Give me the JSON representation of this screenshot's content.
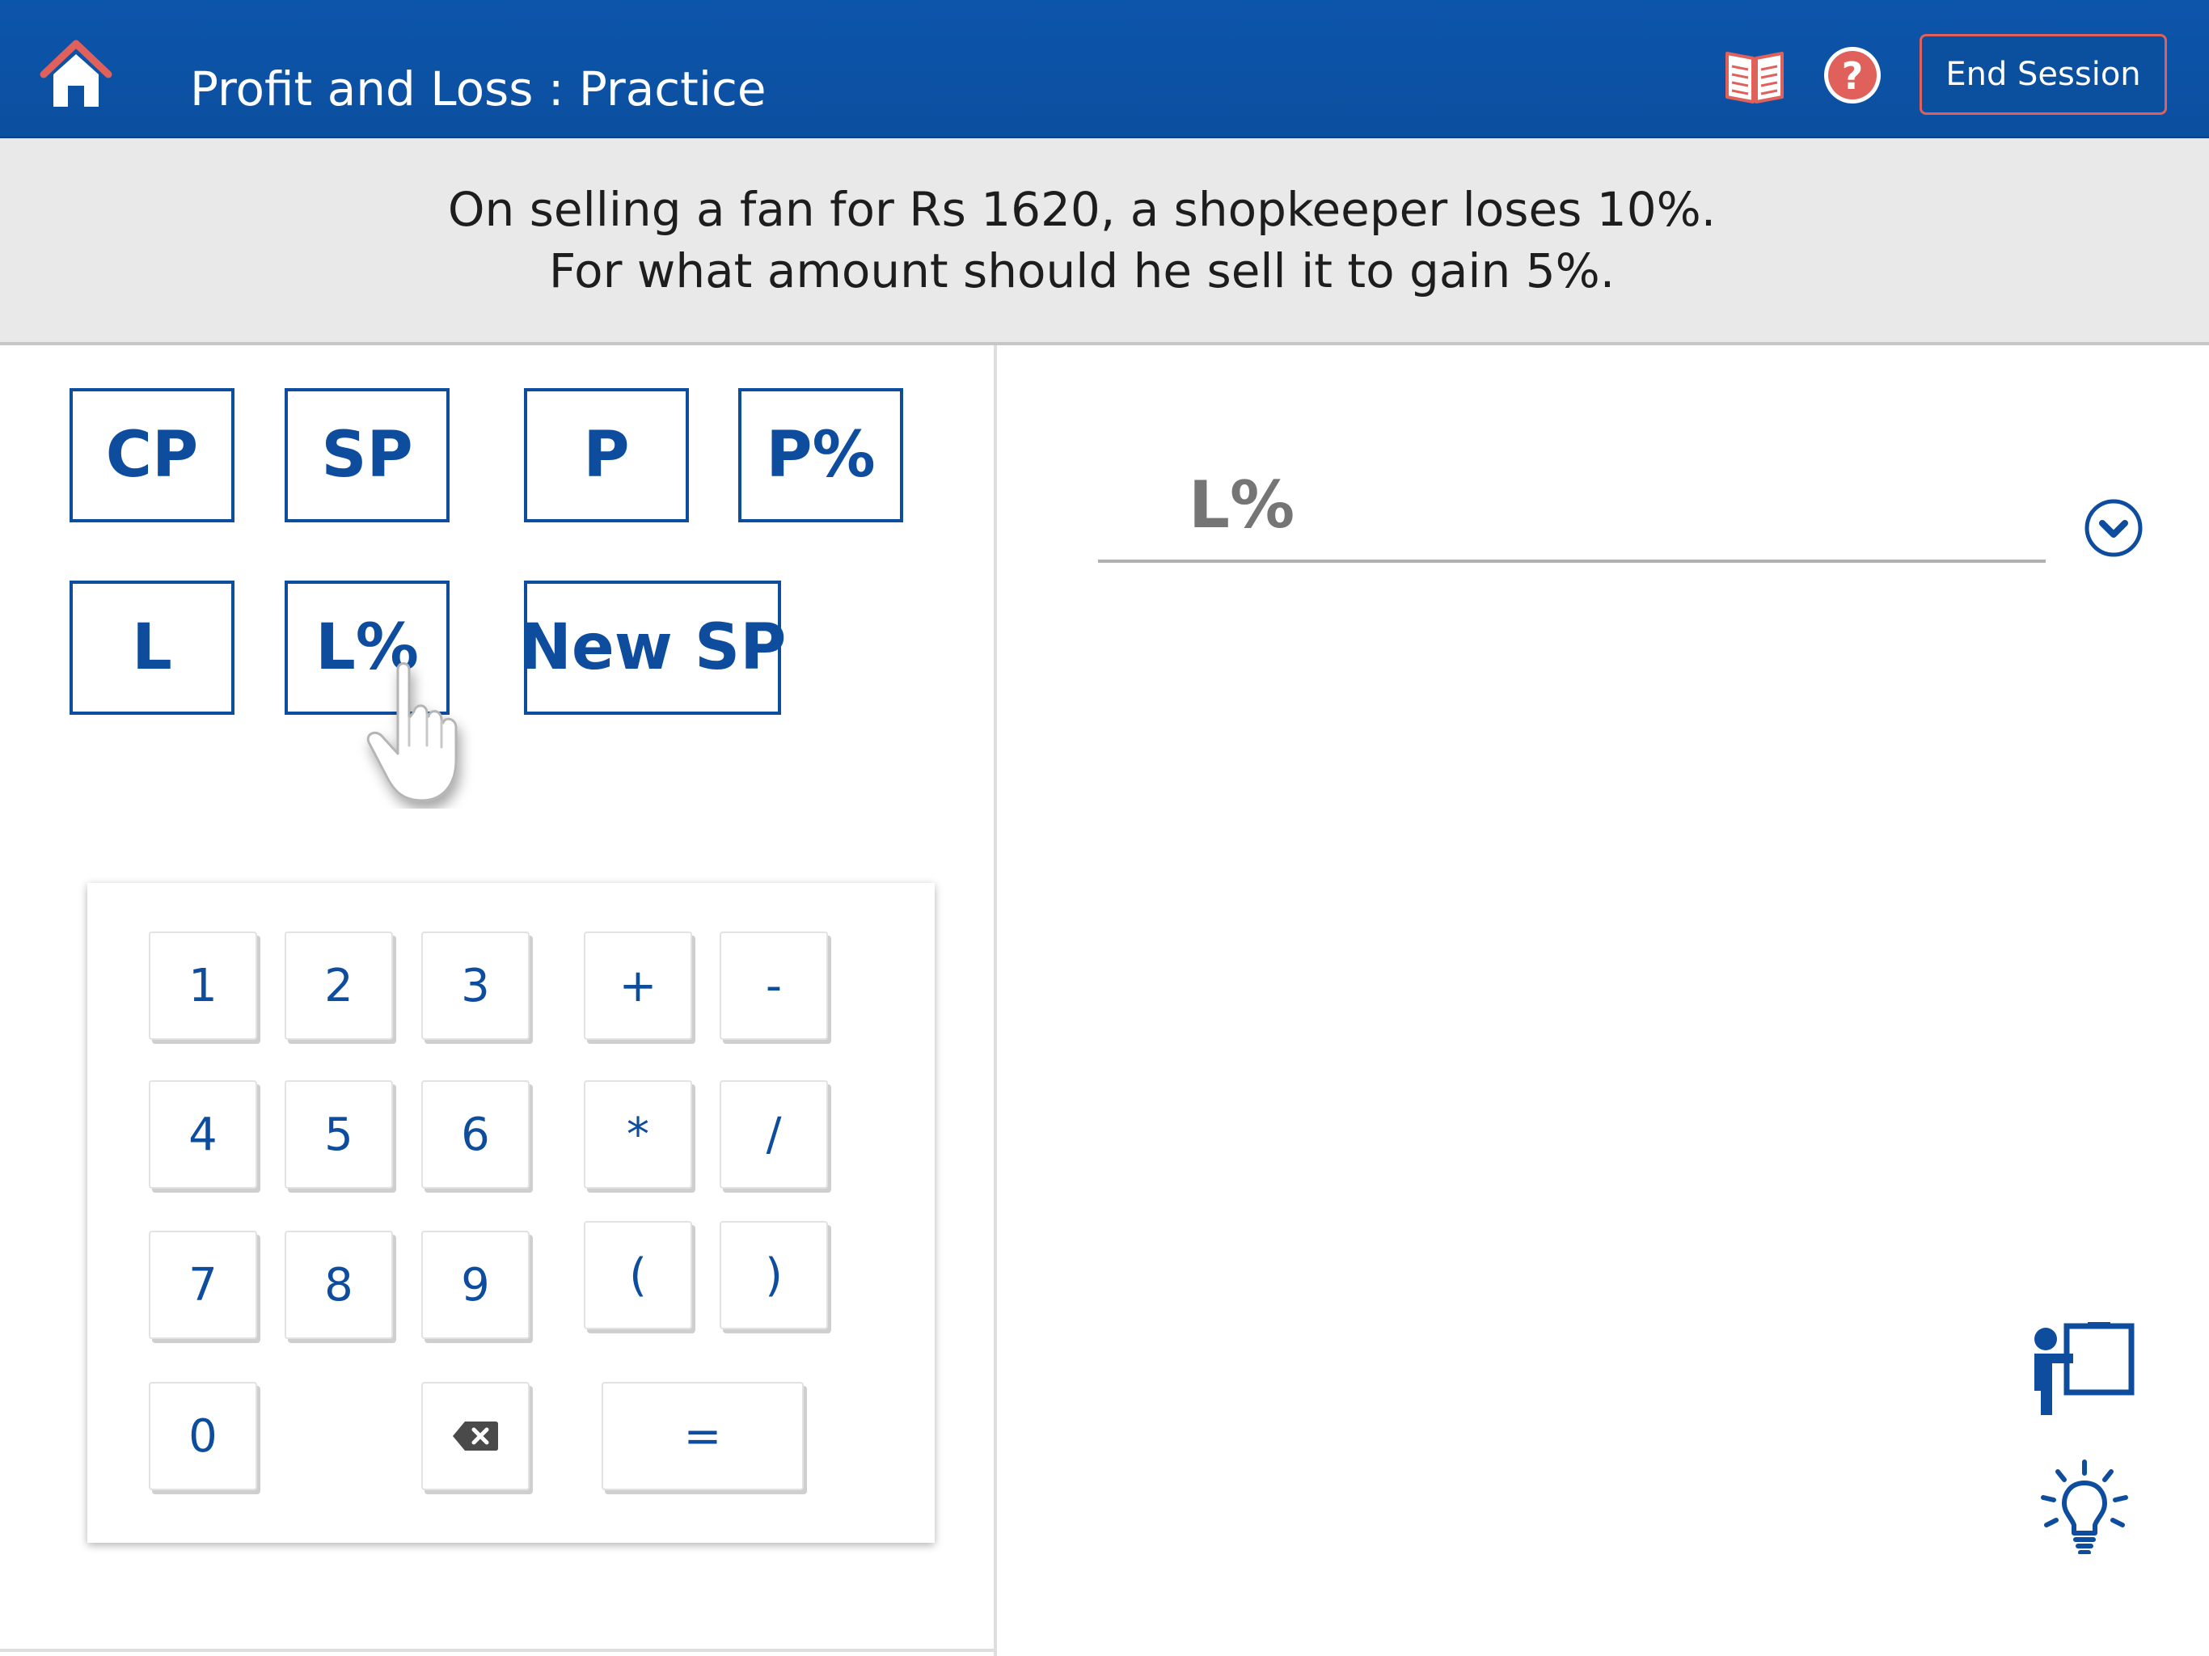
{
  "header": {
    "title": "Profit and Loss : Practice",
    "end_session_label": "End Session",
    "icons": {
      "home": "home-icon",
      "book": "book-icon",
      "help": "help-icon"
    },
    "colors": {
      "bar": "#0b4f9f",
      "end_session_border": "#e0615b",
      "help": "#e0615b"
    }
  },
  "question": {
    "line1": "On selling a fan for Rs 1620, a shopkeeper loses 10%.",
    "line2": "For what amount should he sell it to gain 5%."
  },
  "variables": [
    "CP",
    "SP",
    "P",
    "P%",
    "L",
    "L%",
    "New SP"
  ],
  "keypad": {
    "digits": [
      "1",
      "2",
      "3",
      "4",
      "5",
      "6",
      "7",
      "8",
      "9",
      "0"
    ],
    "operators": [
      "+",
      "-",
      "*",
      "/",
      "(",
      ")"
    ],
    "equals": "=",
    "backspace_icon": "backspace-icon"
  },
  "answer": {
    "placeholder": "L%",
    "dropdown_icon": "chevron-down-icon"
  },
  "side_tools": {
    "teacher_icon": "teacher-board-icon",
    "hint_icon": "lightbulb-icon"
  },
  "accent_color": "#0e4d9e"
}
